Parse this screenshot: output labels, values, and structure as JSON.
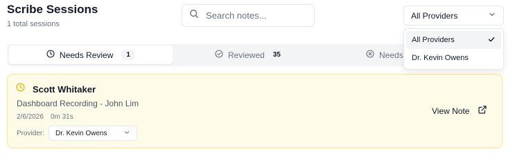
{
  "header": {
    "title": "Scribe Sessions",
    "session_count": "1 total sessions"
  },
  "search": {
    "placeholder": "Search notes...",
    "icon": "search-icon"
  },
  "provider_filter": {
    "selected": "All Providers",
    "options": [
      {
        "label": "All Providers",
        "selected": true
      },
      {
        "label": "Dr. Kevin Owens",
        "selected": false
      }
    ]
  },
  "tabs": [
    {
      "label": "Needs Review",
      "count": "1",
      "icon": "clock-icon",
      "active": true
    },
    {
      "label": "Reviewed",
      "count": "35",
      "icon": "check-circle-icon",
      "active": false
    },
    {
      "label": "Needs",
      "count": "",
      "icon": "x-circle-icon",
      "active": false
    }
  ],
  "session": {
    "patient_name": "Scott Whitaker",
    "recording_title": "Dashboard Recording - John Lim",
    "date": "2/6/2026",
    "duration": "0m 31s",
    "provider_label": "Provider:",
    "provider_value": "Dr. Kevin Owens",
    "view_note_label": "View Note"
  },
  "colors": {
    "card_background": "#fefce8",
    "card_border": "#fde68a",
    "clock_accent": "#eab308"
  }
}
